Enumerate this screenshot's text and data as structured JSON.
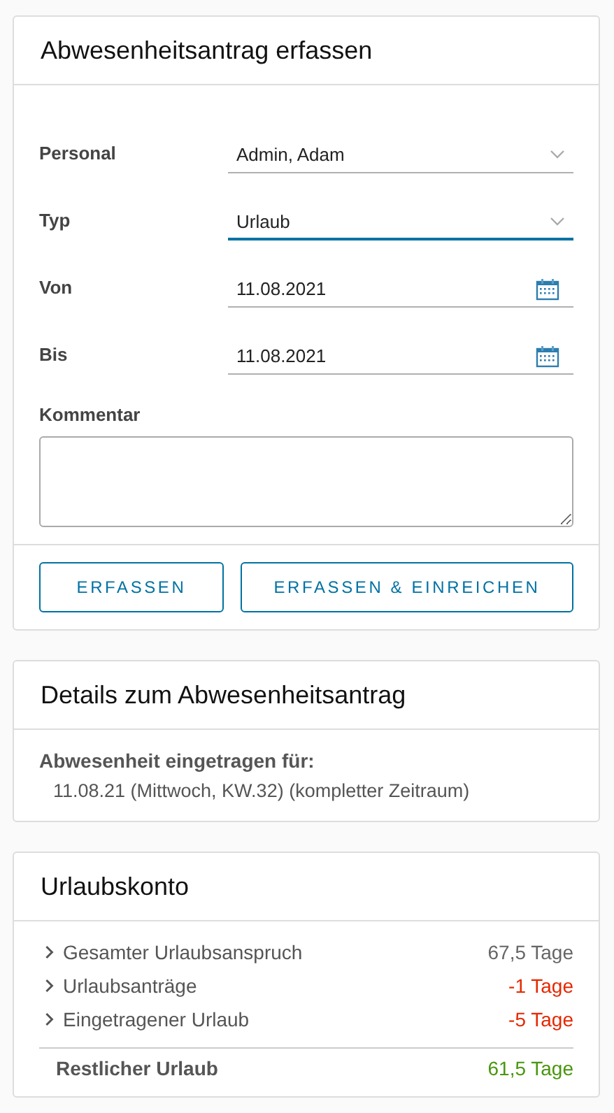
{
  "form": {
    "title": "Abwesenheitsantrag erfassen",
    "fields": [
      {
        "kind": "select",
        "label": "Personal",
        "value": "Admin, Adam",
        "focused": false
      },
      {
        "kind": "select",
        "label": "Typ",
        "value": "Urlaub",
        "focused": true
      },
      {
        "kind": "date",
        "label": "Von",
        "value": "11.08.2021",
        "focused": false
      },
      {
        "kind": "date",
        "label": "Bis",
        "value": "11.08.2021",
        "focused": false
      }
    ],
    "comment": {
      "label": "Kommentar"
    },
    "buttons": [
      "ERFASSEN",
      "ERFASSEN & EINREICHEN"
    ]
  },
  "details": {
    "title": "Details zum Abwesenheitsantrag",
    "heading": "Abwesenheit eingetragen für:",
    "text": "11.08.21 (Mittwoch, KW.32) (kompletter Zeitraum)"
  },
  "account": {
    "title": "Urlaubskonto",
    "rows": [
      {
        "label": "Gesamter Urlaubsanspruch",
        "value": "67,5 Tage",
        "color": "#666666",
        "expanded": false
      },
      {
        "label": "Urlaubsanträge",
        "value": "-1 Tage",
        "color": "#e62700",
        "expanded": false
      },
      {
        "label": "Eingetragener Urlaub",
        "value": "-5 Tage",
        "color": "#e62700",
        "expanded": false
      }
    ],
    "total": {
      "label": "Restlicher Urlaub",
      "value": "61,5 Tage",
      "color": "#48960c"
    }
  }
}
